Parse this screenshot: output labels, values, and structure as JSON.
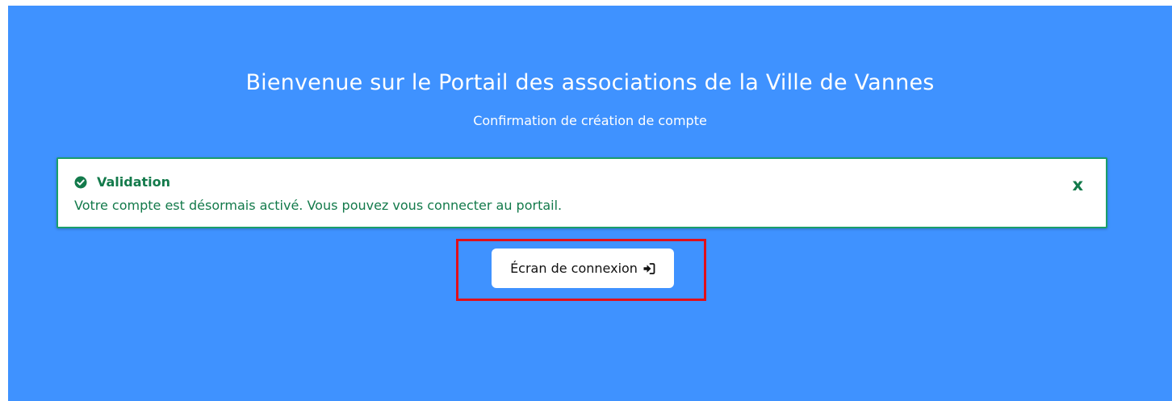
{
  "page": {
    "title": "Bienvenue sur le Portail des associations de la Ville de Vannes",
    "subtitle": "Confirmation de création de compte"
  },
  "alert": {
    "heading": "Validation",
    "message": "Votre compte est désormais activé. Vous pouvez vous connecter au portail.",
    "close_label": "x",
    "icon": "check-circle-icon"
  },
  "actions": {
    "login_label": "Écran de connexion",
    "login_icon": "sign-in-icon"
  },
  "colors": {
    "background": "#3f92ff",
    "success": "#137a4b",
    "alert_border": "#1b9e6b",
    "highlight": "#e0101a"
  }
}
